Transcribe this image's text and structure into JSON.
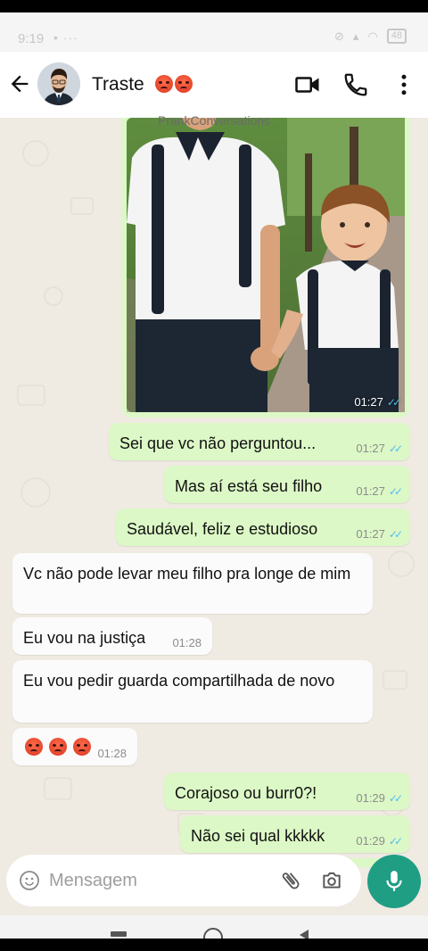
{
  "status_bar": {
    "time": "9:19",
    "dots": "• ···",
    "battery": "48"
  },
  "header": {
    "contact_name": "Traste",
    "icons": [
      "back-arrow-icon",
      "video-call-icon",
      "phone-icon",
      "more-vert-icon"
    ]
  },
  "watermark": "PrankConversations",
  "messages": [
    {
      "type": "image",
      "dir": "out",
      "time": "01:27",
      "ticks": "✓✓"
    },
    {
      "type": "text",
      "dir": "out",
      "text": "Sei que vc não perguntou...",
      "time": "01:27",
      "ticks": "✓✓"
    },
    {
      "type": "text",
      "dir": "out",
      "text": "Mas aí está seu filho",
      "time": "01:27",
      "ticks": "✓✓"
    },
    {
      "type": "text",
      "dir": "out",
      "text": "Saudável, feliz e estudioso",
      "time": "01:27",
      "ticks": "✓✓"
    },
    {
      "type": "text",
      "dir": "in",
      "text": "Vc não pode levar meu filho pra longe de mim"
    },
    {
      "type": "text",
      "dir": "in",
      "text": "Eu vou na justiça",
      "time": "01:28"
    },
    {
      "type": "text",
      "dir": "in",
      "text": "Eu vou pedir guarda compartilhada de novo"
    },
    {
      "type": "emoji",
      "dir": "in",
      "count": 3,
      "time": "01:28"
    },
    {
      "type": "text",
      "dir": "out",
      "text": "Corajoso ou burr0?!",
      "time": "01:29",
      "ticks": "✓✓"
    },
    {
      "type": "text",
      "dir": "out",
      "text": "Não sei qual kkkkk",
      "time": "01:29",
      "ticks": "✓✓"
    }
  ],
  "composer": {
    "placeholder": "Mensagem"
  },
  "colors": {
    "outgoing": "#dcf8c6",
    "incoming": "#fbfbfb",
    "accent": "#1f9e84",
    "ticks": "#53bdeb"
  }
}
